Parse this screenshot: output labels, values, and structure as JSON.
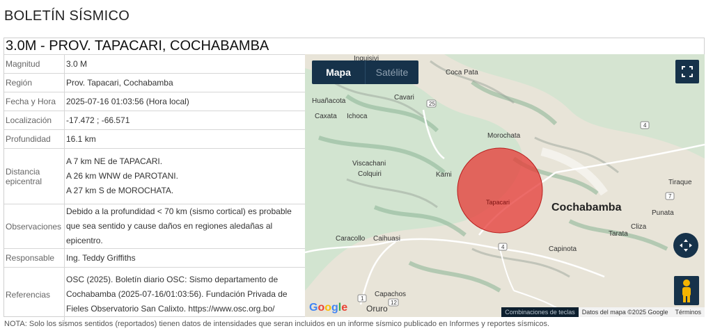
{
  "page_title": "BOLETÍN SÍSMICO",
  "event_title": "3.0M - PROV. TAPACARI, COCHABAMBA",
  "rows": [
    {
      "label": "Magnitud",
      "value": "3.0 M"
    },
    {
      "label": "Región",
      "value": "Prov. Tapacari, Cochabamba"
    },
    {
      "label": "Fecha y Hora",
      "value": "2025-07-16 01:03:56 (Hora local)"
    },
    {
      "label": "Localización",
      "value": "-17.472 ; -66.571"
    },
    {
      "label": "Profundidad",
      "value": "16.1 km"
    }
  ],
  "distance": {
    "label": "Distancia epicentral",
    "lines": [
      "A 7 km NE de TAPACARI.",
      "A 26 km WNW de PAROTANI.",
      "A 27 km S de MOROCHATA."
    ]
  },
  "observations": {
    "label": "Observaciones",
    "value": "Debido a la profundidad < 70 km (sismo cortical) es probable que sea sentido y cause daños en regiones aledañas al epicentro."
  },
  "responsible": {
    "label": "Responsable",
    "value": "Ing. Teddy Griffiths"
  },
  "references": {
    "label": "Referencias",
    "value": "OSC (2025). Boletín diario OSC: Sismo departamento de Cochabamba (2025-07-16/01:03:56). Fundación Privada de Fieles Observatorio San Calixto. https://www.osc.org.bo/"
  },
  "map": {
    "type_map": "Mapa",
    "type_satellite": "Satélite",
    "epicenter_label": "Tapacari",
    "city_big": "Cochabamba",
    "places": [
      "Inquisivi",
      "Coca Pata",
      "Cavari",
      "Huañacota",
      "Caxata",
      "Ichoca",
      "Morochata",
      "Viscachani",
      "Colquiri",
      "Kami",
      "Tiraque",
      "Punata",
      "Cliza",
      "Tarata",
      "Capinota",
      "Caracollo",
      "Caihuasi",
      "Capachos",
      "Oruro"
    ],
    "routes": [
      "25",
      "4",
      "7",
      "4",
      "1",
      "12",
      "31"
    ],
    "attribution": "Combinaciones de teclas",
    "map_data": "Datos del mapa ©2025 Google",
    "terms": "Términos",
    "logo": "Google",
    "circle_color": "#e53935"
  },
  "note": "NOTA: Solo los sismos sentidos (reportados) tienen datos de intensidades que seran incluidos en un informe sísmico publicado en Informes y reportes sísmicos."
}
